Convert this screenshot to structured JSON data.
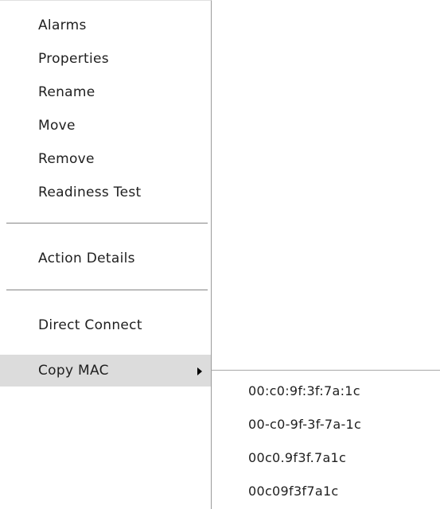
{
  "menu": {
    "items": [
      {
        "label": "Alarms"
      },
      {
        "label": "Properties"
      },
      {
        "label": "Rename"
      },
      {
        "label": "Move"
      },
      {
        "label": "Remove"
      },
      {
        "label": "Readiness Test"
      }
    ],
    "action_details_label": "Action Details",
    "direct_connect_label": "Direct Connect",
    "copy_mac_label": "Copy MAC",
    "copy_mac_arrow_icon": "triangle-right-icon"
  },
  "submenu": {
    "items": [
      {
        "label": "00:c0:9f:3f:7a:1c"
      },
      {
        "label": "00-c0-9f-3f-7a-1c"
      },
      {
        "label": "00c0.9f3f.7a1c"
      },
      {
        "label": "00c09f3f7a1c"
      }
    ]
  }
}
